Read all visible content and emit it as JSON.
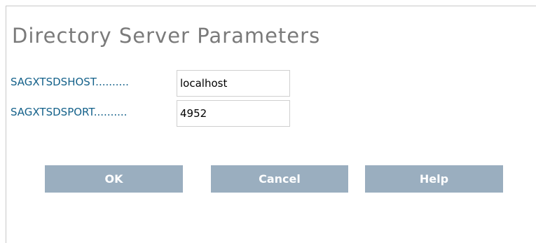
{
  "page": {
    "title": "Directory Server Parameters"
  },
  "fields": {
    "host": {
      "label": "SAGXTSDSHOST..........",
      "value": "localhost"
    },
    "port": {
      "label": "SAGXTSDSPORT..........",
      "value": "4952"
    }
  },
  "buttons": {
    "ok": "OK",
    "cancel": "Cancel",
    "help": "Help"
  },
  "colors": {
    "button_bg": "#9aaebf",
    "label_text": "#14618a",
    "title_text": "#7a7a7a"
  }
}
